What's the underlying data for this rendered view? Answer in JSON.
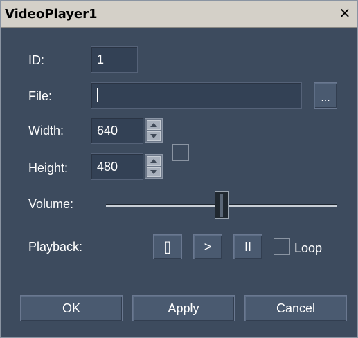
{
  "window": {
    "title": "VideoPlayer1",
    "close_glyph": "✕"
  },
  "fields": {
    "id": {
      "label": "ID:",
      "value": "1"
    },
    "file": {
      "label": "File:",
      "value": "",
      "browse_label": "..."
    },
    "width": {
      "label": "Width:",
      "value": "640"
    },
    "height": {
      "label": "Height:",
      "value": "480"
    }
  },
  "volume": {
    "label": "Volume:",
    "level_fraction": 0.5
  },
  "playback": {
    "label": "Playback:",
    "stop_label": "[]",
    "play_label": ">",
    "pause_label": "II",
    "loop_label": "Loop"
  },
  "buttons": {
    "ok": "OK",
    "apply": "Apply",
    "cancel": "Cancel"
  }
}
